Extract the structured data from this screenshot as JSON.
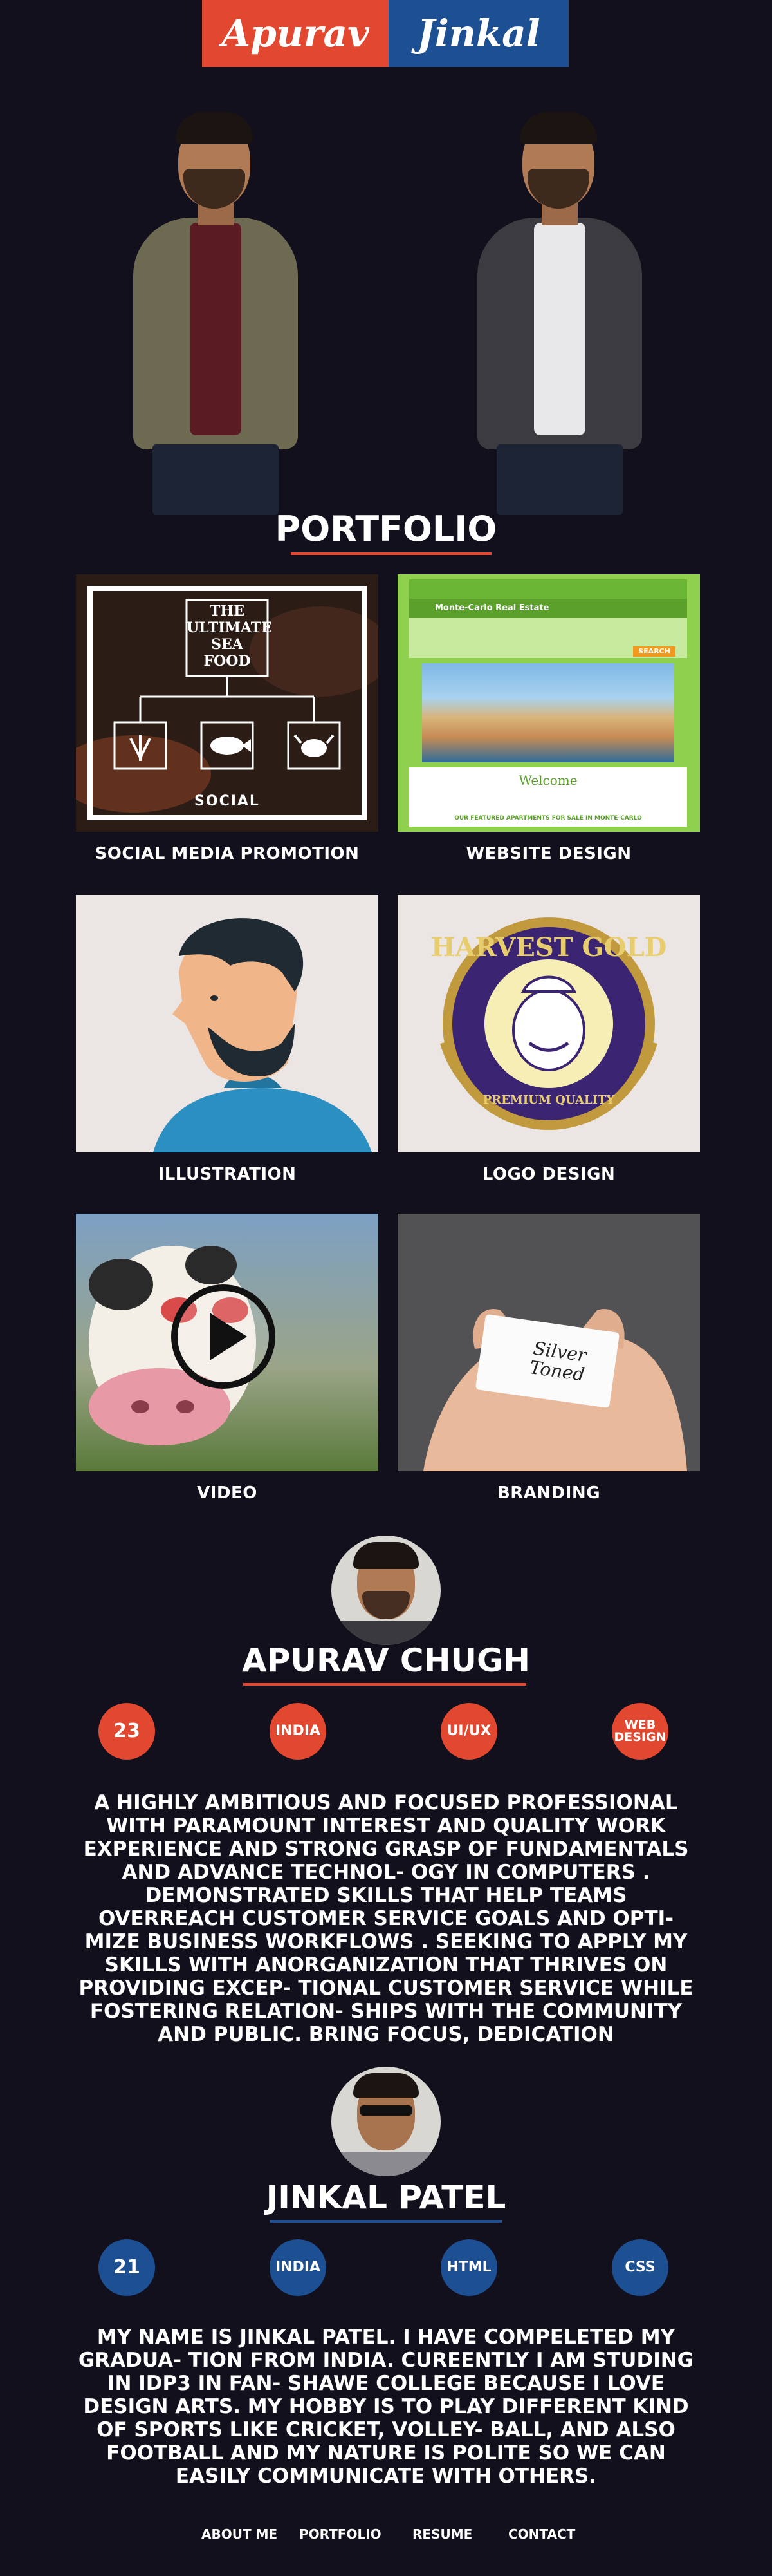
{
  "header": {
    "name_left": "Apurav",
    "name_right": "Jinkal"
  },
  "colors": {
    "background": "#13101e",
    "accent_red": "#e2472f",
    "accent_blue": "#1d4f93"
  },
  "portfolio": {
    "title": "PORTFOLIO",
    "items": [
      {
        "label": "SOCIAL MEDIA PROMOTION"
      },
      {
        "label": "WEBSITE DESIGN"
      },
      {
        "label": "ILLUSTRATION"
      },
      {
        "label": "LOGO DESIGN"
      },
      {
        "label": "VIDEO"
      },
      {
        "label": "BRANDING"
      }
    ],
    "seafood": {
      "line1": "THE",
      "line2": "ULTIMATE",
      "line3": "SEA FOOD",
      "brand": "SOCIAL"
    },
    "website": {
      "site_name": "Monte-Carlo Real Estate",
      "search_label": "SEARCH",
      "welcome": "Welcome",
      "banner": "OUR FEATURED APARTMENTS FOR SALE IN MONTE-CARLO"
    },
    "logo": {
      "top_text": "HARVEST GOLD",
      "bottom_text": "PREMIUM QUALITY"
    },
    "branding": {
      "card_line1": "Silver",
      "card_line2": "Toned"
    }
  },
  "profiles": [
    {
      "name": "APURAV CHUGH",
      "stats": [
        "23",
        "INDIA",
        "UI/UX",
        "WEB DESIGN"
      ],
      "bio": "A highly ambitious and focused professional with paramount interest and quality work experience and strong grasp of fundamentals and advance technol- ogy in computers . Demonstrated skills that help teams overreach customer service goals and opti- mize business workflows . Seeking to apply my skills with anorganization that thrives on providing excep- tional customer service while fostering relation- ships with the community and public. Bring focus, dedication"
    },
    {
      "name": "JINKAL PATEL",
      "stats": [
        "21",
        "INDIA",
        "HTML",
        "CSS"
      ],
      "bio": "My name is Jinkal Patel. I have compeleted my gradua- tion from India. Cureently I am studing in IDP3 in Fan- shawe college because I love design arts. My hobby is to play different kind of sports like cricket, volley- ball, and also football and my nature is polite so we can easily communicate with others."
    }
  ],
  "footer": {
    "links": [
      "ABOUT ME",
      "PORTFOLIO",
      "RESUME",
      "CONTACT"
    ]
  }
}
